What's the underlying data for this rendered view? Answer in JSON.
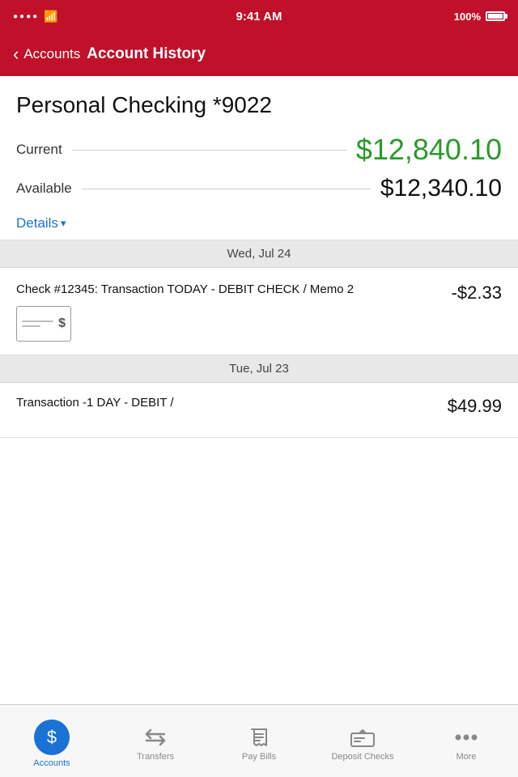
{
  "status_bar": {
    "signal": "●●●●",
    "wifi": "WiFi",
    "time": "9:41 AM",
    "battery_pct": "100%"
  },
  "nav": {
    "back_label": "Accounts",
    "title": "Account History"
  },
  "account": {
    "name": "Personal Checking *9022",
    "current_label": "Current",
    "current_amount": "$12,840.10",
    "available_label": "Available",
    "available_amount": "$12,340.10",
    "details_label": "Details",
    "details_chevron": "▾"
  },
  "sections": [
    {
      "date_header": "Wed, Jul 24",
      "transactions": [
        {
          "description": "Check #12345: Transaction TODAY - DEBIT CHECK / Memo 2",
          "amount": "-$2.33",
          "has_check_image": true
        }
      ]
    },
    {
      "date_header": "Tue, Jul 23",
      "transactions": [
        {
          "description": "Transaction -1 DAY - DEBIT /",
          "amount": "$49.99",
          "has_check_image": false,
          "partial": true
        }
      ]
    }
  ],
  "tab_bar": {
    "items": [
      {
        "id": "accounts",
        "label": "Accounts",
        "icon": "$",
        "active": true
      },
      {
        "id": "transfers",
        "label": "Transfers",
        "icon": "⇄",
        "active": false
      },
      {
        "id": "pay-bills",
        "label": "Pay Bills",
        "icon": "✉",
        "active": false
      },
      {
        "id": "deposit-checks",
        "label": "Deposit Checks",
        "icon": "▤",
        "active": false
      },
      {
        "id": "more",
        "label": "More",
        "icon": "•••",
        "active": false
      }
    ]
  }
}
